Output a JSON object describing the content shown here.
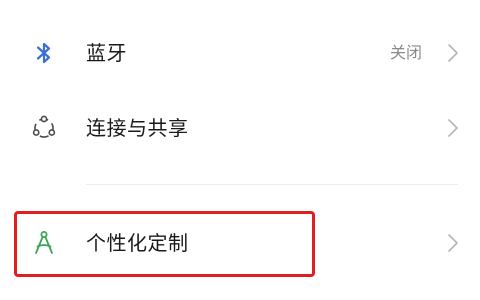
{
  "settings": {
    "items": [
      {
        "label": "蓝牙",
        "value": "关闭",
        "icon": "bluetooth-icon",
        "icon_color": "#3b6fd6"
      },
      {
        "label": "连接与共享",
        "value": "",
        "icon": "share-network-icon",
        "icon_color": "#4a4a4a"
      },
      {
        "label": "个性化定制",
        "value": "",
        "icon": "compass-icon",
        "icon_color": "#3aa655"
      }
    ]
  },
  "colors": {
    "highlight": "#e02020",
    "chevron": "#b5b5b5",
    "value_text": "#8a8a8a",
    "divider": "#ececec"
  }
}
